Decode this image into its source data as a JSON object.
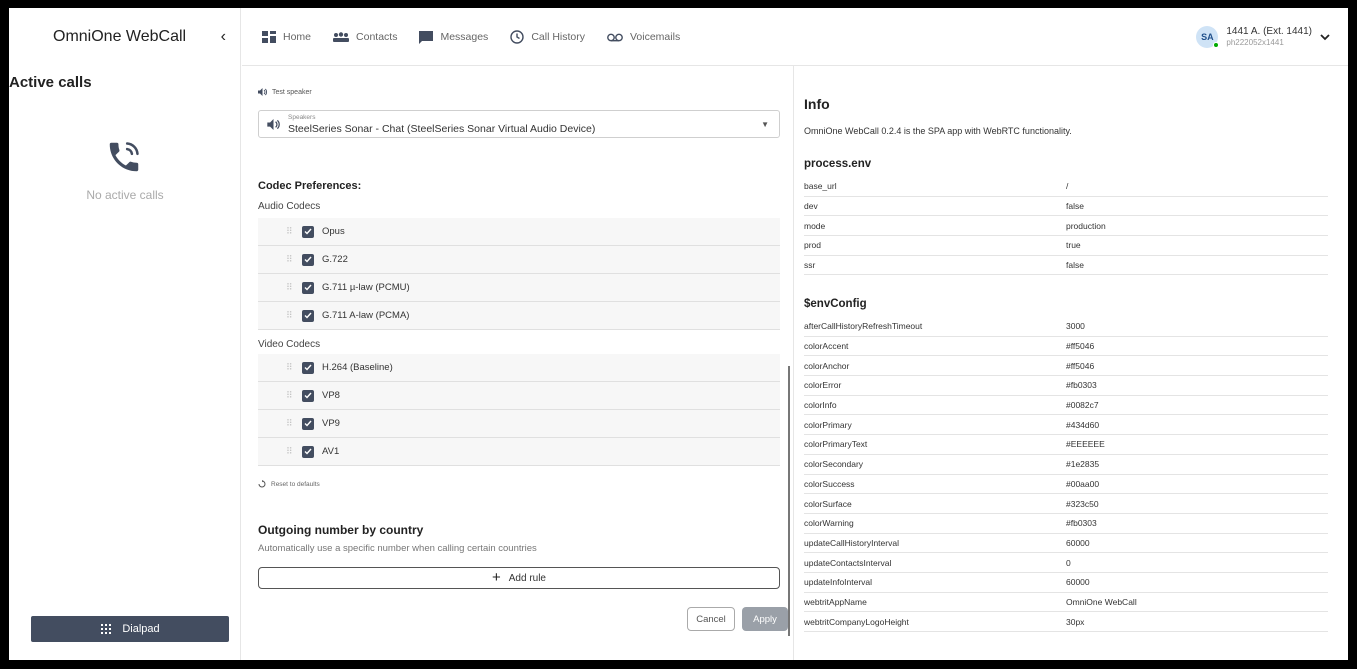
{
  "sidebar": {
    "app_title": "OmniOne WebCall",
    "collapse_glyph": "‹",
    "section_title": "Active calls",
    "empty_text": "No active calls",
    "dialpad_label": "Dialpad"
  },
  "nav": {
    "items": [
      {
        "label": "Home",
        "icon": "home-icon"
      },
      {
        "label": "Contacts",
        "icon": "contacts-icon"
      },
      {
        "label": "Messages",
        "icon": "messages-icon"
      },
      {
        "label": "Call History",
        "icon": "clock-icon"
      },
      {
        "label": "Voicemails",
        "icon": "voicemail-icon"
      }
    ]
  },
  "user": {
    "initials": "SA",
    "name": "1441 A. (Ext. 1441)",
    "id": "ph222052x1441",
    "status_color": "#00aa00"
  },
  "audio": {
    "test_speaker": "Test speaker",
    "speakers_label": "Speakers",
    "speakers_value": "SteelSeries Sonar - Chat (SteelSeries Sonar Virtual Audio Device)"
  },
  "codecs": {
    "title": "Codec Preferences:",
    "audio_label": "Audio Codecs",
    "audio": [
      "Opus",
      "G.722",
      "G.711 µ-law (PCMU)",
      "G.711 A-law (PCMA)"
    ],
    "video_label": "Video Codecs",
    "video": [
      "H.264 (Baseline)",
      "VP8",
      "VP9",
      "AV1"
    ],
    "reset_label": "Reset to defaults"
  },
  "outgoing": {
    "title": "Outgoing number by country",
    "subtitle": "Automatically use a specific number when calling certain countries",
    "add_rule": "Add rule",
    "cancel": "Cancel",
    "apply": "Apply"
  },
  "info": {
    "title": "Info",
    "description": "OmniOne WebCall 0.2.4 is the SPA app with WebRTC functionality.",
    "process_env_title": "process.env",
    "process_env": [
      {
        "key": "base_url",
        "value": "/"
      },
      {
        "key": "dev",
        "value": "false"
      },
      {
        "key": "mode",
        "value": "production"
      },
      {
        "key": "prod",
        "value": "true"
      },
      {
        "key": "ssr",
        "value": "false"
      }
    ],
    "env_config_title": "$envConfig",
    "env_config": [
      {
        "key": "afterCallHistoryRefreshTimeout",
        "value": "3000"
      },
      {
        "key": "colorAccent",
        "value": "#ff5046"
      },
      {
        "key": "colorAnchor",
        "value": "#ff5046"
      },
      {
        "key": "colorError",
        "value": "#fb0303"
      },
      {
        "key": "colorInfo",
        "value": "#0082c7"
      },
      {
        "key": "colorPrimary",
        "value": "#434d60"
      },
      {
        "key": "colorPrimaryText",
        "value": "#EEEEEE"
      },
      {
        "key": "colorSecondary",
        "value": "#1e2835"
      },
      {
        "key": "colorSuccess",
        "value": "#00aa00"
      },
      {
        "key": "colorSurface",
        "value": "#323c50"
      },
      {
        "key": "colorWarning",
        "value": "#fb0303"
      },
      {
        "key": "updateCallHistoryInterval",
        "value": "60000"
      },
      {
        "key": "updateContactsInterval",
        "value": "0"
      },
      {
        "key": "updateInfoInterval",
        "value": "60000"
      },
      {
        "key": "webtritAppName",
        "value": "OmniOne WebCall"
      },
      {
        "key": "webtritCompanyLogoHeight",
        "value": "30px"
      }
    ]
  }
}
